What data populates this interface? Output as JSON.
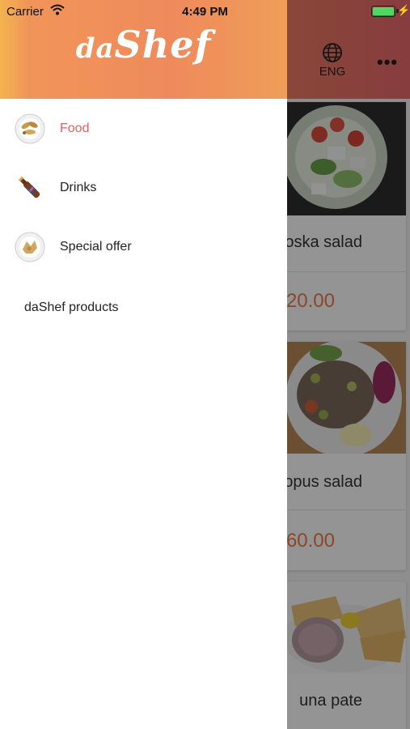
{
  "status_bar": {
    "carrier": "Carrier",
    "time": "4:49 PM",
    "battery_level": 1.0
  },
  "header": {
    "language": "ENG",
    "more_label": "•••"
  },
  "drawer": {
    "logo": "daShef",
    "items": [
      {
        "label": "Food",
        "icon": "food-icon",
        "active": true
      },
      {
        "label": "Drinks",
        "icon": "drinks-bottle-icon",
        "active": false
      },
      {
        "label": "Special offer",
        "icon": "special-offer-icon",
        "active": false
      }
    ],
    "products_link": "daShef products"
  },
  "products": [
    {
      "name": "oska salad",
      "price": "20.00"
    },
    {
      "name": "opus salad",
      "price": "60.00"
    },
    {
      "name": "una pate",
      "price": ""
    }
  ],
  "colors": {
    "accent": "#e0625d",
    "price": "#ef7a48",
    "header_start": "#f5b34f",
    "header_end": "#e9696c"
  }
}
